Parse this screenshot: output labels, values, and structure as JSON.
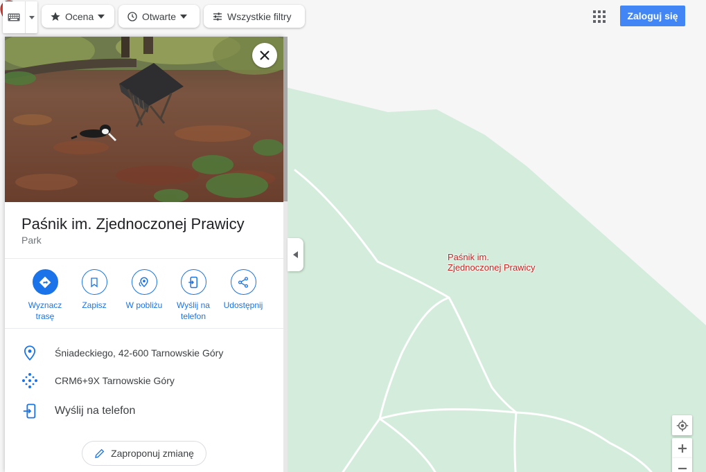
{
  "toolbar": {
    "keyboard_icon": "keyboard-icon",
    "chips": [
      {
        "label": "Ocena",
        "icon": "star-icon"
      },
      {
        "label": "Otwarte",
        "icon": "clock-icon"
      },
      {
        "label": "Wszystkie filtry",
        "icon": "tune-icon"
      }
    ],
    "signin_label": "Zaloguj się"
  },
  "place": {
    "title": "Paśnik im. Zjednoczonej Prawicy",
    "category": "Park",
    "actions": [
      {
        "label": "Wyznacz trasę",
        "icon": "directions-icon"
      },
      {
        "label": "Zapisz",
        "icon": "bookmark-icon"
      },
      {
        "label": "W pobliżu",
        "icon": "nearby-icon"
      },
      {
        "label": "Wyślij na telefon",
        "icon": "send-to-phone-icon"
      },
      {
        "label": "Udostępnij",
        "icon": "share-icon"
      }
    ],
    "address": "Śniadeckiego, 42-600 Tarnowskie Góry",
    "plus_code": "CRM6+9X Tarnowskie Góry",
    "send_to_phone": "Wyślij na telefon",
    "suggest_edit": "Zaproponuj zmianę"
  },
  "map": {
    "marker_label_line1": "Paśnik im.",
    "marker_label_line2": "Zjednoczonej Prawicy",
    "park_color": "#d4ecdb",
    "marker_color": "#ea4335"
  },
  "colors": {
    "accent": "#1a73e8",
    "signin": "#4285f4"
  }
}
